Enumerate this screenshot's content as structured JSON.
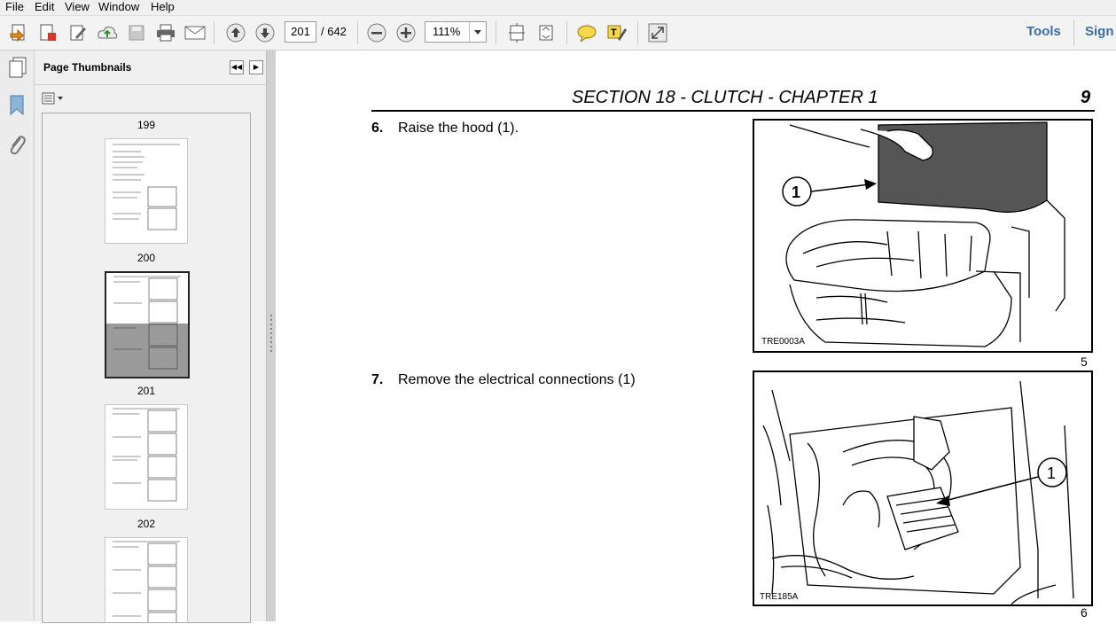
{
  "menu": [
    "File",
    "Edit",
    "View",
    "Window",
    "Help"
  ],
  "toolbar": {
    "current_page": "201",
    "total_pages": "/ 642",
    "zoom": "111%",
    "tools_label": "Tools",
    "sign_label": "Sign"
  },
  "panel": {
    "title": "Page Thumbnails",
    "thumbnails": [
      {
        "label": "199"
      },
      {
        "label": "200"
      },
      {
        "label": "201"
      },
      {
        "label": "202"
      }
    ]
  },
  "document": {
    "header": "SECTION 18 - CLUTCH - CHAPTER 1",
    "page_number": "9",
    "steps": [
      {
        "num": "6.",
        "text": "Raise the hood (1).",
        "figure_code": "TRE0003A",
        "figure_num": "5",
        "callout": "1"
      },
      {
        "num": "7.",
        "text": "Remove the electrical connections (1)",
        "figure_code": "TRE185A",
        "figure_num": "6",
        "callout": "1"
      }
    ]
  }
}
